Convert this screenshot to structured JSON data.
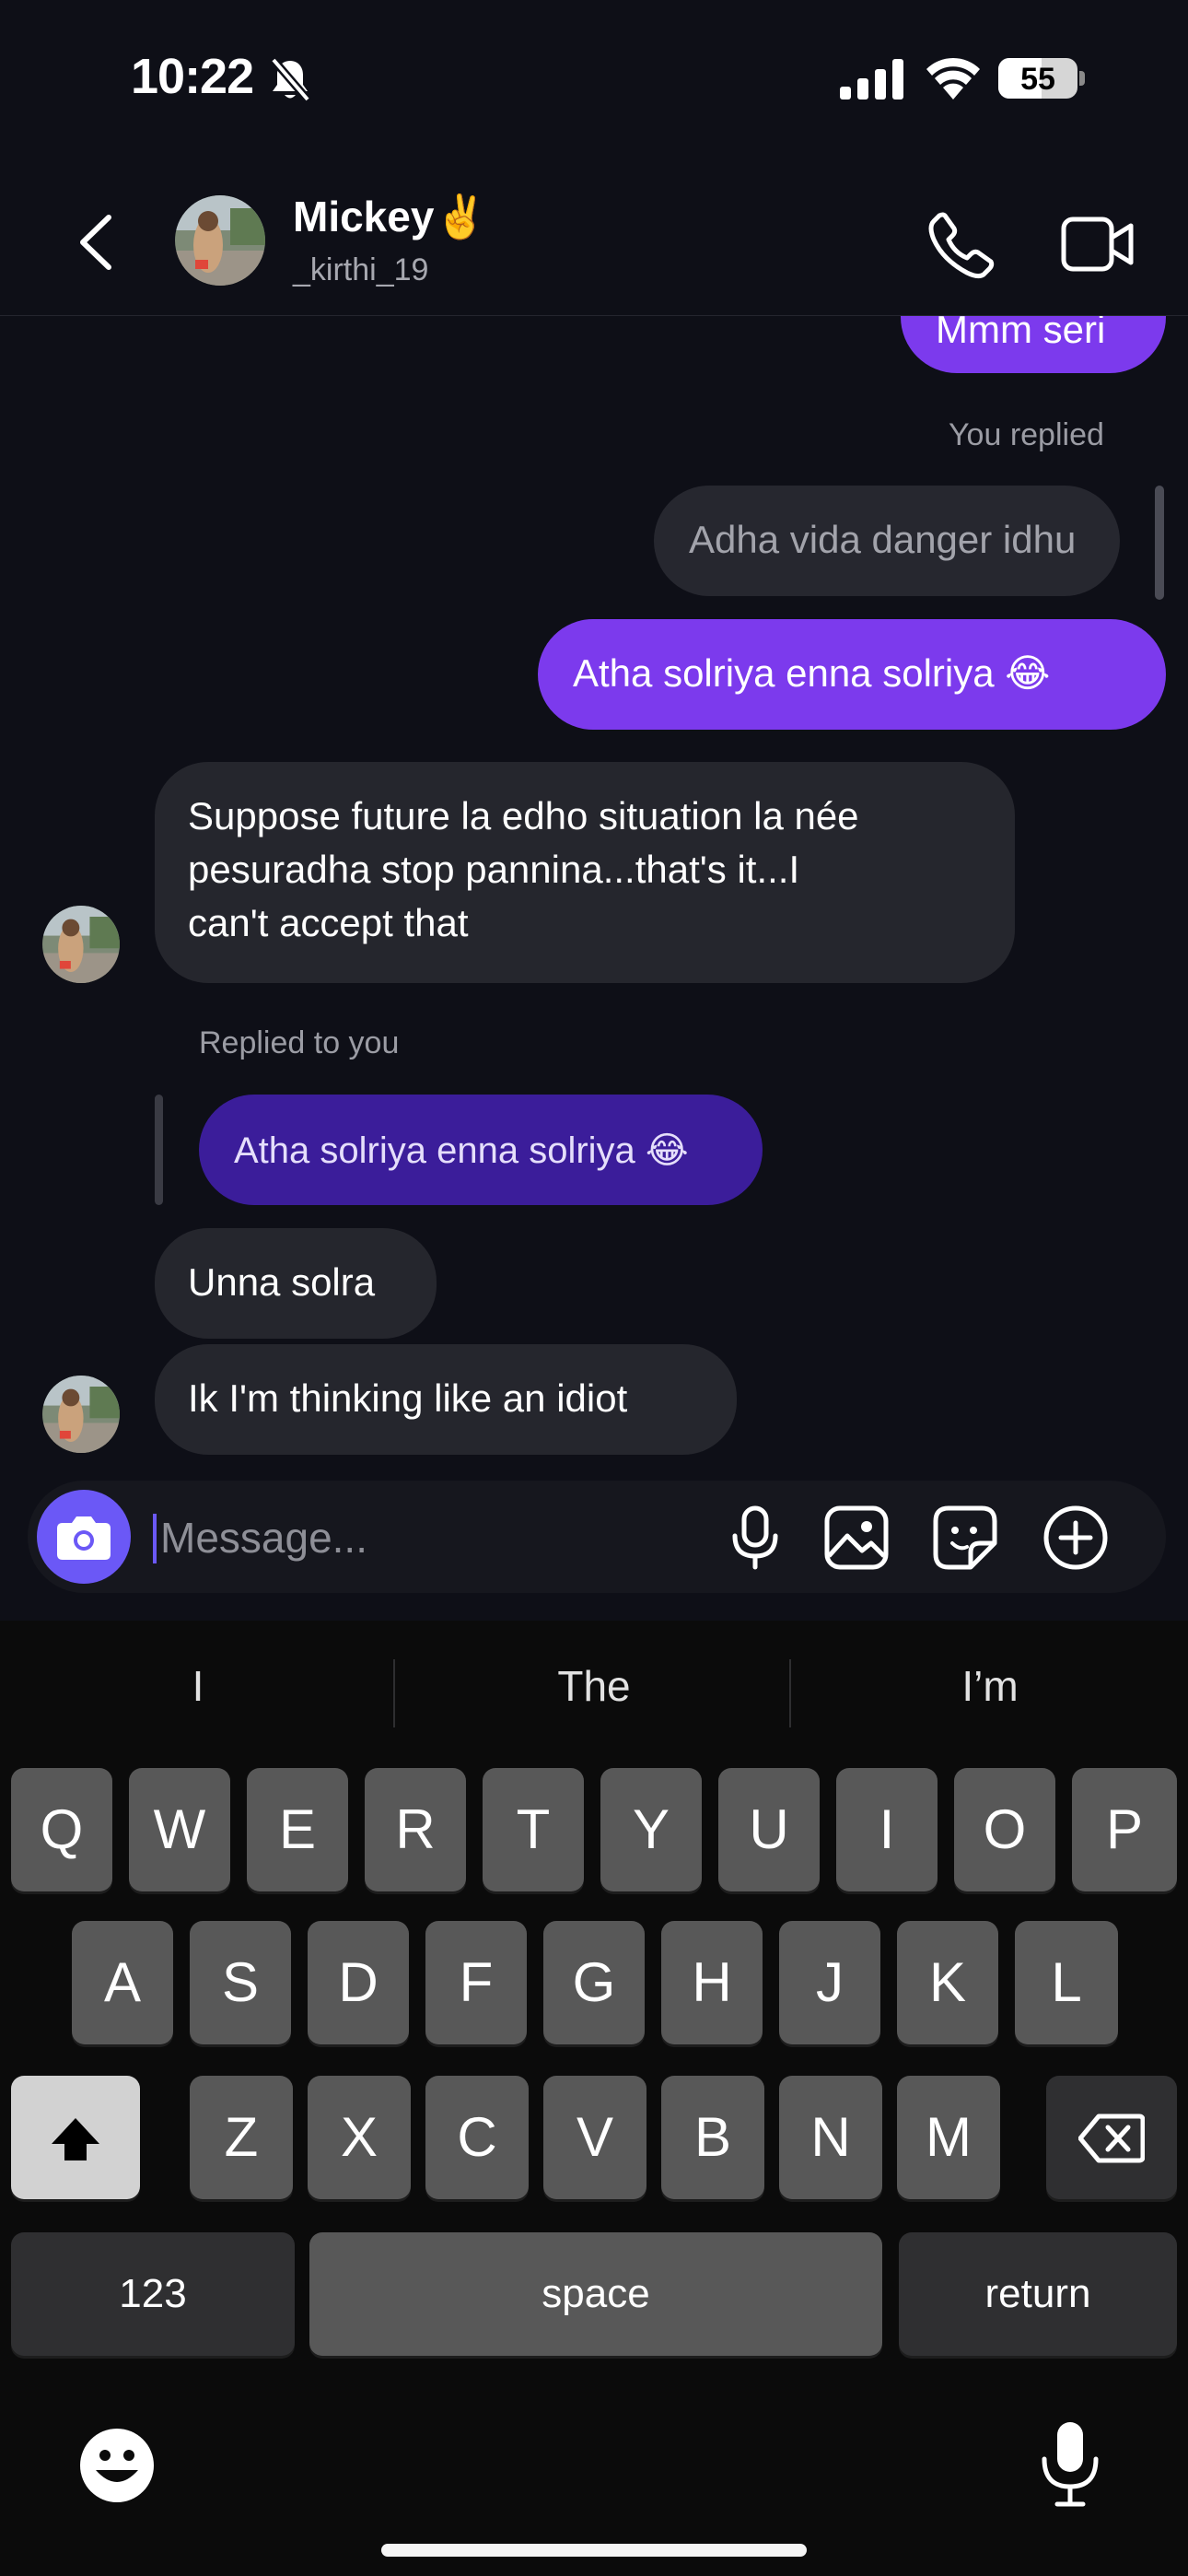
{
  "status_bar": {
    "time": "10:22",
    "battery_text": "55",
    "battery_level": 0.55,
    "icons": [
      "bell-slash-icon",
      "cellular-signal-icon",
      "wifi-icon",
      "battery-icon"
    ]
  },
  "header": {
    "name": "Mickey",
    "name_emoji": "✌️",
    "username": "_kirthi_19",
    "icons": [
      "back-icon",
      "phone-icon",
      "video-camera-icon"
    ]
  },
  "messages": {
    "m0": "Mmm seri",
    "reply_label_1": "You replied",
    "quoted_1": "Adha vida danger idhu",
    "m1": "Atha solriya enna solriya 😂",
    "m2_line1": "Suppose future la edho situation la née",
    "m2_line2": "pesuradha stop pannina...that's it...I",
    "m2_line3": "can't accept that",
    "reply_label_2": "Replied to you",
    "quoted_2": "Atha solriya enna solriya 😂",
    "m3": "Unna solra",
    "m4": "Ik I'm thinking like an idiot"
  },
  "composer": {
    "placeholder": "Message...",
    "value": "",
    "icons": [
      "camera-icon",
      "microphone-icon",
      "gallery-icon",
      "sticker-icon",
      "plus-circle-icon"
    ]
  },
  "keyboard": {
    "suggestions": [
      "I",
      "The",
      "I’m"
    ],
    "row1": [
      "Q",
      "W",
      "E",
      "R",
      "T",
      "Y",
      "U",
      "I",
      "O",
      "P"
    ],
    "row2": [
      "A",
      "S",
      "D",
      "F",
      "G",
      "H",
      "J",
      "K",
      "L"
    ],
    "row3": [
      "Z",
      "X",
      "C",
      "V",
      "B",
      "N",
      "M"
    ],
    "numbers_label": "123",
    "space_label": "space",
    "return_label": "return",
    "icons": [
      "shift-icon",
      "backspace-icon",
      "emoji-icon",
      "dictation-icon"
    ]
  },
  "colors": {
    "outgoing_bubble": "#7c3aed",
    "incoming_bubble": "#25262d",
    "quoted_incoming": "#3b1d9a",
    "camera_button": "#6b58f6",
    "background": "#0e0f17"
  }
}
